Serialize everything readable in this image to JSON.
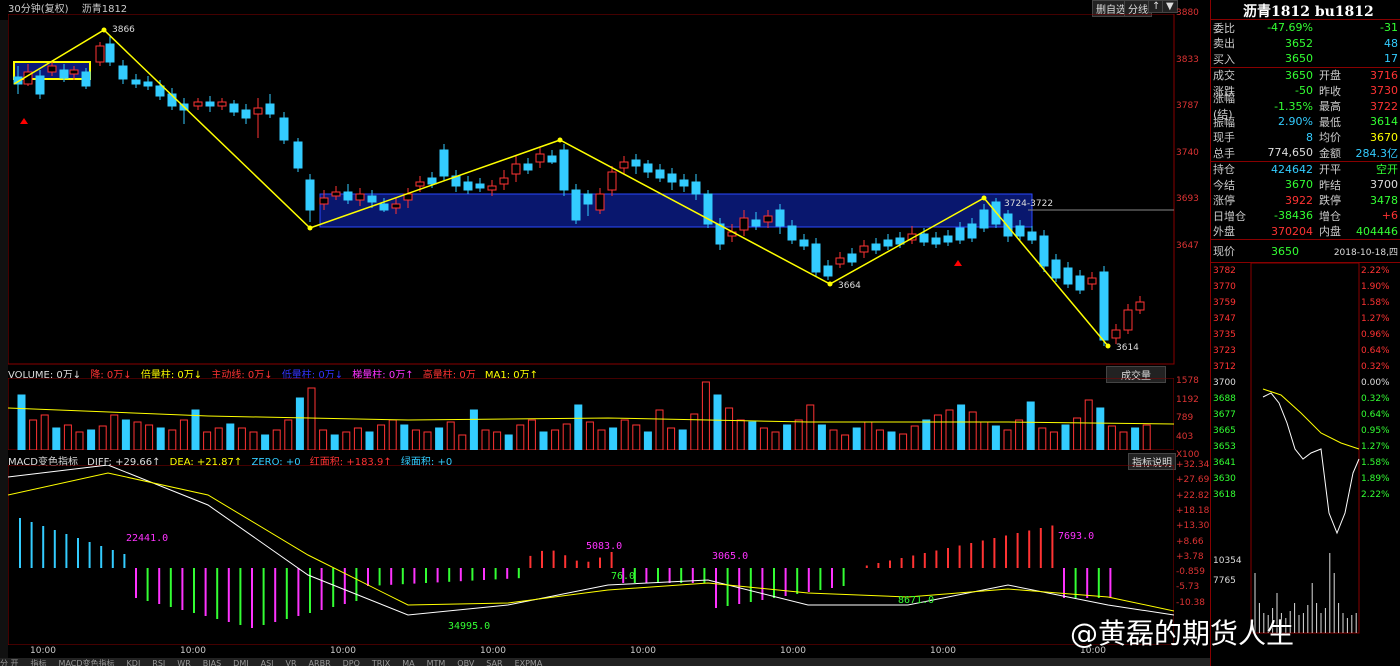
{
  "topbar": {
    "period": "30分钟(复权)",
    "symbol": "沥青1812"
  },
  "toolbar": {
    "btn1": "删自选",
    "btn2": "分线",
    "btn3": "↑",
    "btn4": "▼"
  },
  "price_axis": [
    "3880",
    "3833",
    "3787",
    "3740",
    "3693",
    "3647"
  ],
  "price_marks": {
    "high": "3866",
    "low1": "3664",
    "low2": "3614",
    "line_label": "3724-3722"
  },
  "volume_header": {
    "volume": "VOLUME: 0万↓",
    "v2": "降: 0万↓",
    "v3": "倍量柱: 0万↓",
    "v4": "主动线: 0万↓",
    "v5": "低量柱: 0万↓",
    "v6": "梯量柱: 0万↑",
    "v7": "高量柱: 0万",
    "ma": "MA1: 0万↑",
    "btn": "成交量"
  },
  "volume_axis": [
    "1578",
    "1192",
    "789",
    "403",
    "X100"
  ],
  "macd_header": {
    "title": "MACD变色指标",
    "diff": "DIFF: +29.66↑",
    "dea": "DEA: +21.87↑",
    "zero": "ZERO: +0",
    "red": "红面积: +183.9↑",
    "green": "绿面积: +0",
    "btn": "指标说明"
  },
  "macd_axis": [
    "+32.34",
    "+27.69",
    "+22.82",
    "+18.18",
    "+13.30",
    "+8.66",
    "+3.78",
    "-0.859",
    "-5.73",
    "-10.38"
  ],
  "macd_labels": {
    "a1": "22441.0",
    "a2": "5083.0",
    "a3": "3065.0",
    "a4": "7693.0",
    "g1": "76.0",
    "g2": "34995.0",
    "g3": "8671.0"
  },
  "time_axis": [
    "10:00",
    "10:00",
    "10:00",
    "10:00",
    "10:00",
    "10:00",
    "10:00",
    "10:00",
    "10:00"
  ],
  "bottom_tabs": [
    "分 开",
    "指标",
    "MACD变色指标",
    "KDJ",
    "RSI",
    "WR",
    "BIAS",
    "DMI",
    "ASI",
    "VR",
    "ARBR",
    "DPO",
    "TRIX",
    "MA",
    "MTM",
    "OBV",
    "SAR",
    "EXPMA"
  ],
  "panel": {
    "title": "沥青1812 bu1812",
    "rows1": [
      {
        "l": "委比",
        "v": "-47.69%",
        "vc": "grn",
        "v2": "-31",
        "v2c": "grn"
      },
      {
        "l": "卖出",
        "v": "3652",
        "vc": "grn",
        "v2": "48",
        "v2c": "cyan"
      },
      {
        "l": "买入",
        "v": "3650",
        "vc": "grn",
        "v2": "17",
        "v2c": "cyan"
      }
    ],
    "rows2": [
      {
        "l": "成交",
        "v": "3650",
        "vc": "grn",
        "l2": "开盘",
        "v2": "3716",
        "v2c": "red"
      },
      {
        "l": "涨跌",
        "v": "-50",
        "vc": "grn",
        "l2": "昨收",
        "v2": "3730",
        "v2c": "red"
      },
      {
        "l": "涨幅(结)",
        "v": "-1.35%",
        "vc": "grn",
        "l2": "最高",
        "v2": "3722",
        "v2c": "red"
      },
      {
        "l": "振幅",
        "v": "2.90%",
        "vc": "cyan",
        "l2": "最低",
        "v2": "3614",
        "v2c": "grn"
      },
      {
        "l": "现手",
        "v": "8",
        "vc": "cyan",
        "l2": "均价",
        "v2": "3670",
        "v2c": "yel"
      },
      {
        "l": "总手",
        "v": "774,650",
        "vc": "wht",
        "l2": "金额",
        "v2": "284.3亿",
        "v2c": "cyan"
      }
    ],
    "rows3": [
      {
        "l": "持仓",
        "v": "424642",
        "vc": "cyan",
        "l2": "开平",
        "v2": "空开",
        "v2c": "grn"
      },
      {
        "l": "今结",
        "v": "3670",
        "vc": "grn",
        "l2": "昨结",
        "v2": "3700",
        "v2c": "wht"
      },
      {
        "l": "涨停",
        "v": "3922",
        "vc": "red",
        "l2": "跌停",
        "v2": "3478",
        "v2c": "grn"
      },
      {
        "l": "日增仓",
        "v": "-38436",
        "vc": "grn",
        "l2": "增仓",
        "v2": "+6",
        "v2c": "red"
      },
      {
        "l": "外盘",
        "v": "370204",
        "vc": "red",
        "l2": "内盘",
        "v2": "404446",
        "v2c": "grn"
      }
    ],
    "now_label": "现价",
    "now_val": "3650",
    "date": "2018-10-18,四",
    "mini_left": [
      "3782",
      "3770",
      "3759",
      "3747",
      "3735",
      "3723",
      "3712",
      "3700",
      "3688",
      "3677",
      "3665",
      "3653",
      "3641",
      "3630",
      "3618"
    ],
    "mini_right": [
      "2.22%",
      "1.90%",
      "1.58%",
      "1.27%",
      "0.96%",
      "0.64%",
      "0.32%",
      "0.00%",
      "0.32%",
      "0.64%",
      "0.95%",
      "1.27%",
      "1.58%",
      "1.89%",
      "2.22%"
    ],
    "mini_vol": [
      "10354",
      "7765"
    ]
  },
  "watermark": "@黄磊的期货人生"
}
